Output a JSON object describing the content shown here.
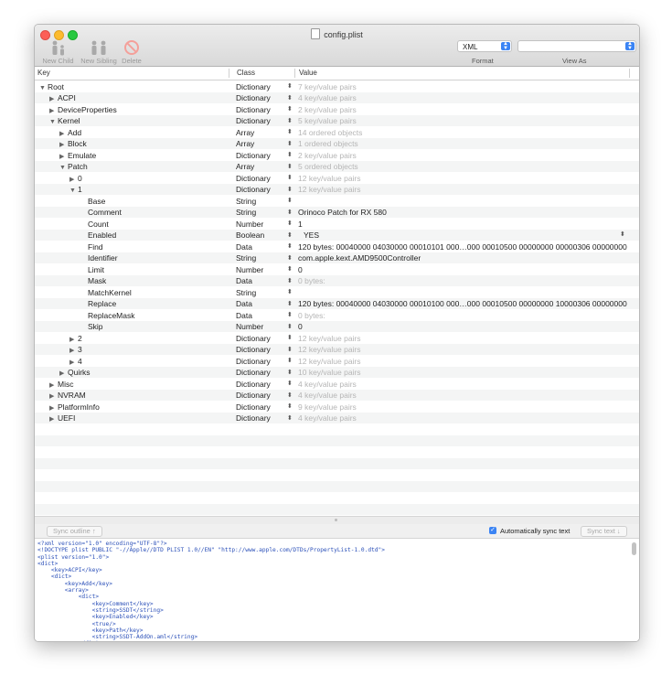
{
  "window": {
    "title": "config.plist"
  },
  "toolbar": {
    "new_child": "New Child",
    "new_sibling": "New Sibling",
    "delete": "Delete",
    "format_value": "XML",
    "format_label": "Format",
    "view_as_label": "View As"
  },
  "columns": {
    "key": "Key",
    "class": "Class",
    "value": "Value"
  },
  "rows": [
    {
      "key": "Root",
      "depth": 0,
      "tri": "open",
      "class": "Dictionary",
      "value": "7 key/value pairs",
      "dim": true
    },
    {
      "key": "ACPI",
      "depth": 1,
      "tri": "closed",
      "class": "Dictionary",
      "value": "4 key/value pairs",
      "dim": true
    },
    {
      "key": "DeviceProperties",
      "depth": 1,
      "tri": "closed",
      "class": "Dictionary",
      "value": "2 key/value pairs",
      "dim": true
    },
    {
      "key": "Kernel",
      "depth": 1,
      "tri": "open",
      "class": "Dictionary",
      "value": "5 key/value pairs",
      "dim": true
    },
    {
      "key": "Add",
      "depth": 2,
      "tri": "closed",
      "class": "Array",
      "value": "14 ordered objects",
      "dim": true
    },
    {
      "key": "Block",
      "depth": 2,
      "tri": "closed",
      "class": "Array",
      "value": "1 ordered objects",
      "dim": true
    },
    {
      "key": "Emulate",
      "depth": 2,
      "tri": "closed",
      "class": "Dictionary",
      "value": "2 key/value pairs",
      "dim": true
    },
    {
      "key": "Patch",
      "depth": 2,
      "tri": "open",
      "class": "Array",
      "value": "5 ordered objects",
      "dim": true
    },
    {
      "key": "0",
      "depth": 3,
      "tri": "closed",
      "class": "Dictionary",
      "value": "12 key/value pairs",
      "dim": true
    },
    {
      "key": "1",
      "depth": 3,
      "tri": "open",
      "class": "Dictionary",
      "value": "12 key/value pairs",
      "dim": true
    },
    {
      "key": "Base",
      "depth": 4,
      "tri": "",
      "class": "String",
      "value": "",
      "dim": false
    },
    {
      "key": "Comment",
      "depth": 4,
      "tri": "",
      "class": "String",
      "value": "Orinoco Patch for RX 580",
      "dim": false
    },
    {
      "key": "Count",
      "depth": 4,
      "tri": "",
      "class": "Number",
      "value": "1",
      "dim": false
    },
    {
      "key": "Enabled",
      "depth": 4,
      "tri": "",
      "class": "Boolean",
      "value": "YES",
      "dim": false,
      "popup": true
    },
    {
      "key": "Find",
      "depth": 4,
      "tri": "",
      "class": "Data",
      "value": "120 bytes: 00040000 04030000 00010101 000…000 00010500 00000000 00000306 00000000",
      "dim": false
    },
    {
      "key": "Identifier",
      "depth": 4,
      "tri": "",
      "class": "String",
      "value": "com.apple.kext.AMD9500Controller",
      "dim": false
    },
    {
      "key": "Limit",
      "depth": 4,
      "tri": "",
      "class": "Number",
      "value": "0",
      "dim": false
    },
    {
      "key": "Mask",
      "depth": 4,
      "tri": "",
      "class": "Data",
      "value": "0 bytes:",
      "dim": true
    },
    {
      "key": "MatchKernel",
      "depth": 4,
      "tri": "",
      "class": "String",
      "value": "",
      "dim": false
    },
    {
      "key": "Replace",
      "depth": 4,
      "tri": "",
      "class": "Data",
      "value": "120 bytes: 00040000 04030000 00010100 000…000 00010500 00000000 10000306 00000000",
      "dim": false
    },
    {
      "key": "ReplaceMask",
      "depth": 4,
      "tri": "",
      "class": "Data",
      "value": "0 bytes:",
      "dim": true
    },
    {
      "key": "Skip",
      "depth": 4,
      "tri": "",
      "class": "Number",
      "value": "0",
      "dim": false
    },
    {
      "key": "2",
      "depth": 3,
      "tri": "closed",
      "class": "Dictionary",
      "value": "12 key/value pairs",
      "dim": true
    },
    {
      "key": "3",
      "depth": 3,
      "tri": "closed",
      "class": "Dictionary",
      "value": "12 key/value pairs",
      "dim": true
    },
    {
      "key": "4",
      "depth": 3,
      "tri": "closed",
      "class": "Dictionary",
      "value": "12 key/value pairs",
      "dim": true
    },
    {
      "key": "Quirks",
      "depth": 2,
      "tri": "closed",
      "class": "Dictionary",
      "value": "10 key/value pairs",
      "dim": true
    },
    {
      "key": "Misc",
      "depth": 1,
      "tri": "closed",
      "class": "Dictionary",
      "value": "4 key/value pairs",
      "dim": true
    },
    {
      "key": "NVRAM",
      "depth": 1,
      "tri": "closed",
      "class": "Dictionary",
      "value": "4 key/value pairs",
      "dim": true
    },
    {
      "key": "PlatformInfo",
      "depth": 1,
      "tri": "closed",
      "class": "Dictionary",
      "value": "9 key/value pairs",
      "dim": true
    },
    {
      "key": "UEFI",
      "depth": 1,
      "tri": "closed",
      "class": "Dictionary",
      "value": "4 key/value pairs",
      "dim": true
    }
  ],
  "source_bar": {
    "sync_outline": "Sync outline ↑",
    "auto_sync": "Automatically sync text",
    "sync_text": "Sync text ↓"
  },
  "source_lines": [
    "<?xml version=\"1.0\" encoding=\"UTF-8\"?>",
    "<!DOCTYPE plist PUBLIC \"-//Apple//DTD PLIST 1.0//EN\" \"http://www.apple.com/DTDs/PropertyList-1.0.dtd\">",
    "<plist version=\"1.0\">",
    "<dict>",
    "    <key>ACPI</key>",
    "    <dict>",
    "        <key>Add</key>",
    "        <array>",
    "            <dict>",
    "                <key>Comment</key>",
    "                <string>SSDT</string>",
    "                <key>Enabled</key>",
    "                <true/>",
    "                <key>Path</key>",
    "                <string>SSDT-AddOn.aml</string>",
    "            </dict>"
  ]
}
